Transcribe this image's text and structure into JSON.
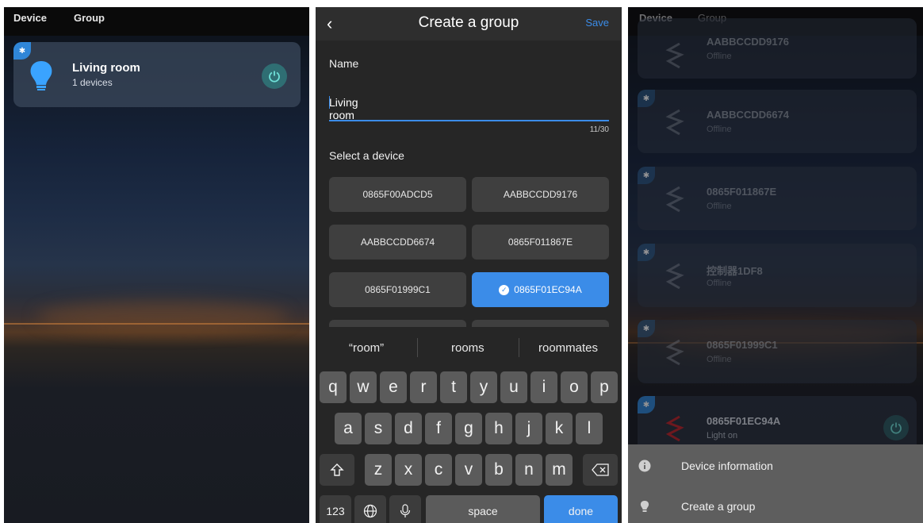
{
  "panel1": {
    "tabs": [
      "Device",
      "Group"
    ],
    "group": {
      "name": "Living room",
      "count": "1 devices"
    },
    "icons": [
      "bluetooth-icon",
      "bulb-icon",
      "power-icon"
    ]
  },
  "panel2": {
    "header": {
      "back": "‹",
      "title": "Create a group",
      "save": "Save"
    },
    "name_label": "Name",
    "name_value": "Living room",
    "counter": "11/30",
    "select_label": "Select a device",
    "devices": [
      "0865F00ADCD5",
      "AABBCCDD9176",
      "AABBCCDD6674",
      "0865F011867E",
      "0865F01999C1",
      "0865F01EC94A"
    ],
    "selected_device": "0865F01EC94A",
    "suggestions": [
      "“room”",
      "rooms",
      "roommates"
    ],
    "keys_row1": [
      "q",
      "w",
      "e",
      "r",
      "t",
      "y",
      "u",
      "i",
      "o",
      "p"
    ],
    "keys_row2": [
      "a",
      "s",
      "d",
      "f",
      "g",
      "h",
      "j",
      "k",
      "l"
    ],
    "keys_row3": [
      "z",
      "x",
      "c",
      "v",
      "b",
      "n",
      "m"
    ],
    "key_123": "123",
    "key_space": "space",
    "key_done": "done"
  },
  "panel3": {
    "tabs": [
      "Device",
      "Group"
    ],
    "devices": [
      {
        "name": "AABBCCDD9176",
        "status": "Offline"
      },
      {
        "name": "AABBCCDD6674",
        "status": "Offline"
      },
      {
        "name": "0865F011867E",
        "status": "Offline"
      },
      {
        "name": "控制器1DF8",
        "status": "Offline"
      },
      {
        "name": "0865F01999C1",
        "status": "Offline"
      },
      {
        "name": "0865F01EC94A",
        "status": "Light on"
      }
    ],
    "menu": [
      "Device information",
      "Create a group"
    ]
  },
  "colors": {
    "accent": "#3b8ce8",
    "power": "#2f6e73",
    "card": "#384658"
  }
}
